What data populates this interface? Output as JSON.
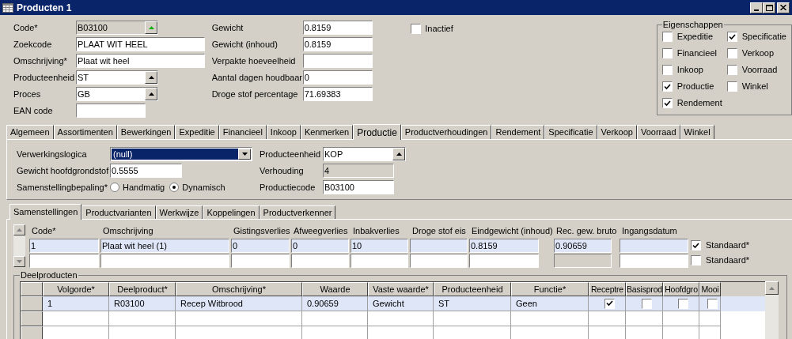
{
  "window": {
    "title": "Producten 1"
  },
  "fields_left": [
    {
      "label": "Code*",
      "value": "B03100",
      "kind": "lookup",
      "readonly": true
    },
    {
      "label": "Zoekcode",
      "value": "PLAAT WIT HEEL",
      "kind": "text"
    },
    {
      "label": "Omschrijving*",
      "value": "Plaat wit heel",
      "kind": "text"
    },
    {
      "label": "Producteenheid",
      "value": "ST",
      "kind": "combo"
    },
    {
      "label": "Proces",
      "value": "GB",
      "kind": "combo"
    },
    {
      "label": "EAN code",
      "kind": "text"
    }
  ],
  "fields_right": [
    {
      "label": "Gewicht",
      "value": "0.8159"
    },
    {
      "label": "Gewicht (inhoud)",
      "value": "0.8159"
    },
    {
      "label": "Verpakte hoeveelheid"
    },
    {
      "label": "Aantal dagen houdbaar",
      "value": "0"
    },
    {
      "label": "Droge stof percentage",
      "value": "71.69383"
    }
  ],
  "inactief": {
    "label": "Inactief",
    "checked": false
  },
  "eigenschappen": {
    "title": "Eigenschappen",
    "items": [
      {
        "label": "Expeditie",
        "checked": false
      },
      {
        "label": "Financieel",
        "checked": false
      },
      {
        "label": "Inkoop",
        "checked": false
      },
      {
        "label": "Productie",
        "checked": true
      },
      {
        "label": "Rendement",
        "checked": true
      },
      {
        "label": "Specificatie",
        "checked": true
      },
      {
        "label": "Verkoop",
        "checked": false
      },
      {
        "label": "Voorraad",
        "checked": false
      },
      {
        "label": "Winkel",
        "checked": false
      }
    ]
  },
  "tabs": [
    {
      "label": "Algemeen",
      "selected": false
    },
    {
      "label": "Assortimenten",
      "selected": false
    },
    {
      "label": "Bewerkingen",
      "selected": false
    },
    {
      "label": "Expeditie",
      "selected": false
    },
    {
      "label": "Financieel",
      "selected": false
    },
    {
      "label": "Inkoop",
      "selected": false
    },
    {
      "label": "Kenmerken",
      "selected": false
    },
    {
      "label": "Productie",
      "selected": true
    },
    {
      "label": "Productverhoudingen",
      "selected": false
    },
    {
      "label": "Rendement",
      "selected": false
    },
    {
      "label": "Specificatie",
      "selected": false
    },
    {
      "label": "Verkoop",
      "selected": false
    },
    {
      "label": "Voorraad",
      "selected": false
    },
    {
      "label": "Winkel",
      "selected": false
    }
  ],
  "productie": {
    "verwerkingslogica": {
      "label": "Verwerkingslogica",
      "value": "(null)"
    },
    "gewicht_hoofdgrondstof": {
      "label": "Gewicht hoofdgrondstof",
      "value": "0.5555"
    },
    "samenstellingbepaling": {
      "label": "Samenstellingbepaling*",
      "options": [
        {
          "label": "Handmatig",
          "selected": false
        },
        {
          "label": "Dynamisch",
          "selected": true
        }
      ]
    },
    "right_fields": [
      {
        "label": "Producteenheid",
        "value": "KOP",
        "kind": "combo"
      },
      {
        "label": "Verhouding",
        "value": "4",
        "kind": "text",
        "readonly": true
      },
      {
        "label": "Productiecode",
        "value": "B03100",
        "kind": "text"
      }
    ]
  },
  "subtabs": [
    {
      "label": "Samenstellingen",
      "selected": true
    },
    {
      "label": "Productvarianten",
      "selected": false
    },
    {
      "label": "Werkwijze",
      "selected": false
    },
    {
      "label": "Koppelingen",
      "selected": false
    },
    {
      "label": "Productverkenner",
      "selected": false
    }
  ],
  "samenstellingen": {
    "columns": [
      {
        "label": "Code*"
      },
      {
        "label": "Omschrijving"
      },
      {
        "label": "Gistingsverlies"
      },
      {
        "label": "Afweegverlies"
      },
      {
        "label": "Inbakverlies"
      },
      {
        "label": "Droge stof eis"
      },
      {
        "label": "Eindgewicht (inhoud)"
      },
      {
        "label": "Rec. gew. bruto",
        "readonly": true
      },
      {
        "label": "Ingangsdatum"
      }
    ],
    "rows": [
      {
        "selected": true,
        "cells": [
          {
            "value": "1"
          },
          {
            "value": "Plaat wit heel (1)"
          },
          {
            "value": "0"
          },
          {
            "value": "0"
          },
          {
            "value": "10"
          },
          {},
          {
            "value": "0.8159"
          },
          {
            "value": "0.90659"
          },
          {}
        ],
        "standaard": {
          "label": "Standaard*",
          "checked": true
        }
      },
      {
        "selected": false,
        "standaard": {
          "label": "Standaard*",
          "checked": false
        }
      }
    ]
  },
  "deelproducten": {
    "title": "Deelproducten",
    "columns": [
      {
        "label": "Volgorde*",
        "kind": "text"
      },
      {
        "label": "Deelproduct*",
        "kind": "text"
      },
      {
        "label": "Omschrijving*",
        "kind": "text"
      },
      {
        "label": "Waarde",
        "kind": "text"
      },
      {
        "label": "Vaste waarde*",
        "kind": "text"
      },
      {
        "label": "Producteenheid",
        "kind": "text"
      },
      {
        "label": "Functie*",
        "kind": "text"
      },
      {
        "label": "Receptre",
        "kind": "check"
      },
      {
        "label": "Basisprod",
        "kind": "check"
      },
      {
        "label": "Hoofdgro",
        "kind": "check"
      },
      {
        "label": "Mooi",
        "kind": "check"
      }
    ],
    "rows": [
      {
        "selected": true,
        "cells": [
          {
            "value": "1"
          },
          {
            "value": "R03100"
          },
          {
            "value": "Recep Witbrood"
          },
          {
            "value": "0.90659"
          },
          {
            "value": "Gewicht"
          },
          {
            "value": "ST"
          },
          {
            "value": "Geen"
          },
          {
            "checked": true
          },
          {
            "checked": false
          },
          {
            "checked": false
          },
          {
            "checked": false
          }
        ]
      },
      {
        "selected": false
      },
      {
        "selected": false
      }
    ]
  }
}
